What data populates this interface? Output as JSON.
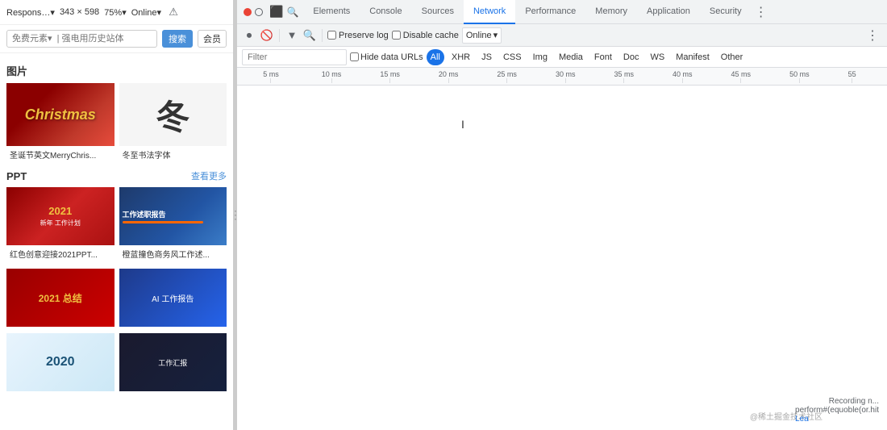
{
  "left_panel": {
    "top_bar": {
      "responsive_label": "Respons…▾",
      "dimensions": "343 × 598",
      "zoom": "75%▾",
      "online": "Online▾"
    },
    "search": {
      "placeholder": "免费元素▾  | 强电用历史站体",
      "search_btn": "搜索",
      "vip_btn": "会员"
    },
    "image_section": {
      "title": "图片",
      "cards": [
        {
          "type": "christmas",
          "caption": "圣诞节英文MerryChris..."
        },
        {
          "type": "winter",
          "caption": "冬至书法字体"
        }
      ]
    },
    "ppt_section": {
      "title": "PPT",
      "view_more": "查看更多",
      "cards": [
        {
          "type": "ppt_red",
          "caption": "红色创意迎接2021PPT..."
        },
        {
          "type": "ppt_blue",
          "caption": "橙蓝撞色商务风工作述..."
        },
        {
          "type": "ppt_red2",
          "caption": ""
        },
        {
          "type": "ppt_blue2",
          "caption": ""
        },
        {
          "type": "ppt_2020",
          "caption": ""
        },
        {
          "type": "ppt_dark",
          "caption": ""
        }
      ]
    }
  },
  "devtools": {
    "tabs": [
      {
        "label": "Elements",
        "active": false
      },
      {
        "label": "Console",
        "active": false
      },
      {
        "label": "Sources",
        "active": false
      },
      {
        "label": "Network",
        "active": true
      },
      {
        "label": "Performance",
        "active": false
      },
      {
        "label": "Memory",
        "active": false
      },
      {
        "label": "Application",
        "active": false
      },
      {
        "label": "Security",
        "active": false
      }
    ],
    "toolbar": {
      "preserve_log_label": "Preserve log",
      "disable_cache_label": "Disable cache",
      "online_label": "Online",
      "online_dropdown_arrow": "▾",
      "more_options": "⋮"
    },
    "filter": {
      "placeholder": "Filter",
      "hide_data_urls_label": "Hide data URLs",
      "type_buttons": [
        "All",
        "XHR",
        "JS",
        "CSS",
        "Img",
        "Media",
        "Font",
        "Doc",
        "WS",
        "Manifest",
        "Other"
      ]
    },
    "timeline": {
      "ticks": [
        {
          "label": "5 ms",
          "pos_percent": 4
        },
        {
          "label": "10 ms",
          "pos_percent": 13
        },
        {
          "label": "15 ms",
          "pos_percent": 22
        },
        {
          "label": "20 ms",
          "pos_percent": 31
        },
        {
          "label": "25 ms",
          "pos_percent": 40
        },
        {
          "label": "30 ms",
          "pos_percent": 49
        },
        {
          "label": "35 ms",
          "pos_percent": 58
        },
        {
          "label": "40 ms",
          "pos_percent": 67
        },
        {
          "label": "45 ms",
          "pos_percent": 76
        },
        {
          "label": "50 ms",
          "pos_percent": 85
        },
        {
          "label": "55",
          "pos_percent": 94
        }
      ]
    },
    "status": {
      "recording_note": "Recording n...",
      "watermark": "@稀土掘金技术社区",
      "footer_text": "perform#(equoble(or.hit",
      "lea_label": "Lea"
    }
  }
}
